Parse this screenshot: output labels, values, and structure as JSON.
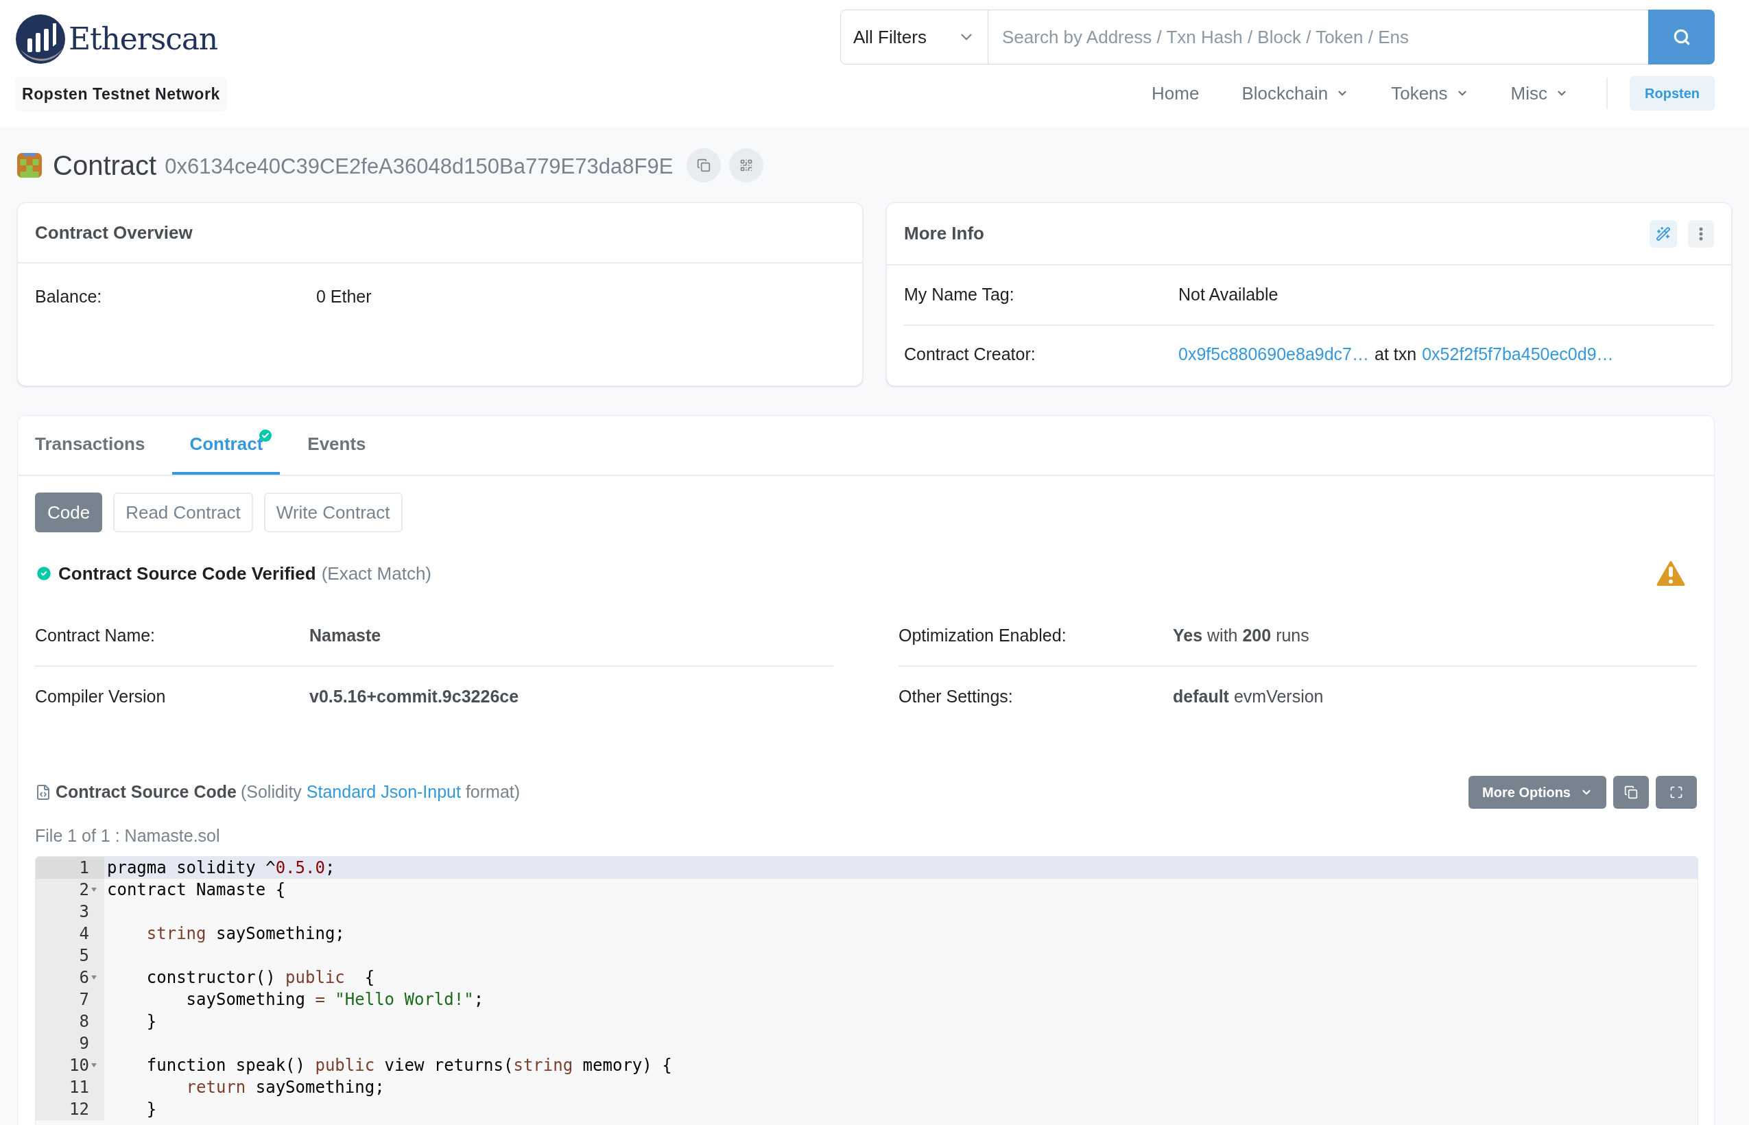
{
  "header": {
    "logo_text": "Etherscan",
    "network_badge": "Ropsten Testnet Network",
    "filter": "All Filters",
    "search": {
      "placeholder": "Search by Address / Txn Hash / Block / Token / Ens"
    },
    "nav": [
      {
        "label": "Home",
        "dropdown": false
      },
      {
        "label": "Blockchain",
        "dropdown": true
      },
      {
        "label": "Tokens",
        "dropdown": true
      },
      {
        "label": "Misc",
        "dropdown": true
      }
    ],
    "network_button": "Ropsten"
  },
  "page_title": {
    "label": "Contract",
    "address": "0x6134ce40C39CE2feA36048d150Ba779E73da8F9E"
  },
  "overview": {
    "title": "Contract Overview",
    "rows": [
      {
        "label": "Balance:",
        "value": "0 Ether"
      }
    ]
  },
  "more_info": {
    "title": "More Info",
    "name_tag": {
      "label": "My Name Tag:",
      "value": "Not Available"
    },
    "creator": {
      "label": "Contract Creator:",
      "address": "0x9f5c880690e8a9dc7…",
      "middle": "at txn",
      "txn": "0x52f2f5f7ba450ec0d9…"
    }
  },
  "tabs": [
    {
      "label": "Transactions",
      "selected": false,
      "verified": false
    },
    {
      "label": "Contract",
      "selected": true,
      "verified": true
    },
    {
      "label": "Events",
      "selected": false,
      "verified": false
    }
  ],
  "sub_buttons": [
    {
      "label": "Code",
      "selected": true
    },
    {
      "label": "Read Contract",
      "selected": false
    },
    {
      "label": "Write Contract",
      "selected": false
    }
  ],
  "verification": {
    "title": "Contract Source Code Verified",
    "note": "(Exact Match)",
    "warning": true
  },
  "details": [
    [
      {
        "label": "Contract Name:",
        "value": "**Namaste**"
      },
      {
        "label": "Compiler Version",
        "value": "**v0.5.16+commit.9c3226ce**"
      }
    ],
    [
      {
        "label": "Optimization Enabled:",
        "value": "**Yes** with **200** runs"
      },
      {
        "label": "Other Settings:",
        "value": "**default** evmVersion"
      }
    ]
  ],
  "source": {
    "title": "Contract Source Code",
    "prefix": "(Solidity",
    "link": "Standard Json-Input",
    "suffix": "format)",
    "more_options": "More Options",
    "file_label": "File 1 of 1 : Namaste.sol",
    "lines": [
      {
        "number": "1",
        "active": true,
        "fold": false,
        "tokens": [
          {
            "text": "pragma solidity ^",
            "kind": "plain"
          },
          {
            "text": "0.5.0",
            "kind": "number"
          },
          {
            "text": ";",
            "kind": "plain"
          }
        ]
      },
      {
        "number": "2",
        "active": false,
        "fold": true,
        "tokens": [
          {
            "text": "contract Namaste {",
            "kind": "plain"
          }
        ]
      },
      {
        "number": "3",
        "active": false,
        "fold": false
      },
      {
        "number": "4",
        "active": false,
        "fold": false,
        "tokens": [
          {
            "text": "    string",
            "kind": "keyword"
          },
          {
            "text": " saySomething;",
            "kind": "plain"
          }
        ]
      },
      {
        "number": "5",
        "active": false,
        "fold": false
      },
      {
        "number": "6",
        "active": false,
        "fold": true,
        "tokens": [
          {
            "text": "    constructor() ",
            "kind": "plain"
          },
          {
            "text": "public",
            "kind": "keyword"
          },
          {
            "text": "  {",
            "kind": "plain"
          }
        ]
      },
      {
        "number": "7",
        "active": false,
        "fold": false,
        "tokens": [
          {
            "text": "        saySomething ",
            "kind": "plain"
          },
          {
            "text": "=",
            "kind": "keyword"
          },
          {
            "text": " \"Hello World!\"",
            "kind": "string"
          },
          {
            "text": ";",
            "kind": "plain"
          }
        ]
      },
      {
        "number": "8",
        "active": false,
        "fold": false,
        "tokens": [
          {
            "text": "    }",
            "kind": "plain"
          }
        ]
      },
      {
        "number": "9",
        "active": false,
        "fold": false
      },
      {
        "number": "10",
        "active": false,
        "fold": true,
        "tokens": [
          {
            "text": "    function speak() ",
            "kind": "plain"
          },
          {
            "text": "public",
            "kind": "keyword"
          },
          {
            "text": " view returns(",
            "kind": "plain"
          },
          {
            "text": "string",
            "kind": "keyword"
          },
          {
            "text": " memory) {",
            "kind": "plain"
          }
        ]
      },
      {
        "number": "11",
        "active": false,
        "fold": false,
        "tokens": [
          {
            "text": "        return",
            "kind": "keyword"
          },
          {
            "text": " saySomething;",
            "kind": "plain"
          }
        ]
      },
      {
        "number": "12",
        "active": false,
        "fold": false,
        "tokens": [
          {
            "text": "    }",
            "kind": "plain"
          }
        ]
      }
    ]
  }
}
